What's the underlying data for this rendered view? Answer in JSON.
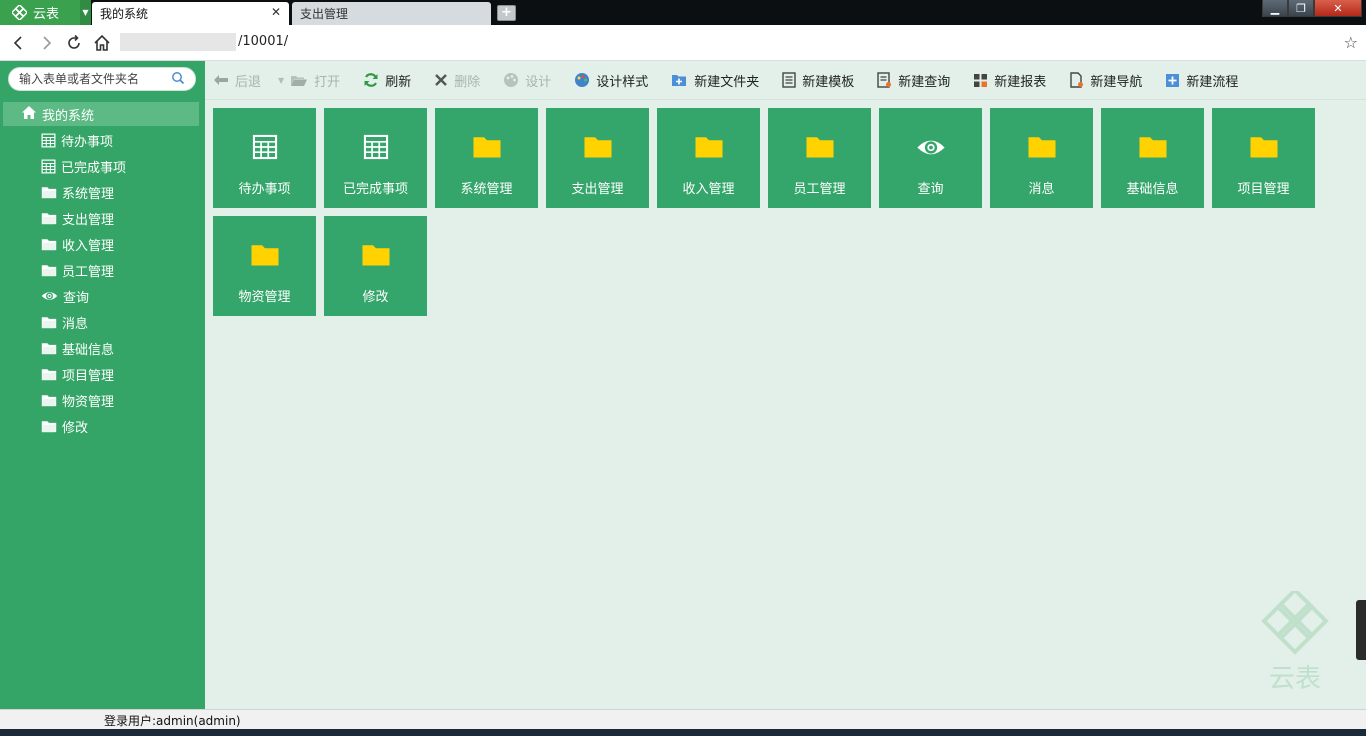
{
  "browser": {
    "app_name": "云表",
    "tabs": [
      {
        "label": "我的系统",
        "active": true
      },
      {
        "label": "支出管理",
        "active": false
      }
    ],
    "url": "/10001/"
  },
  "sidebar": {
    "search_placeholder": "输入表单或者文件夹名",
    "root": {
      "label": "我的系统",
      "icon": "home-icon"
    },
    "items": [
      {
        "label": "待办事项",
        "icon": "table-icon"
      },
      {
        "label": "已完成事项",
        "icon": "table-icon"
      },
      {
        "label": "系统管理",
        "icon": "folder-icon"
      },
      {
        "label": "支出管理",
        "icon": "folder-icon"
      },
      {
        "label": "收入管理",
        "icon": "folder-icon"
      },
      {
        "label": "员工管理",
        "icon": "folder-icon"
      },
      {
        "label": "查询",
        "icon": "eye-icon"
      },
      {
        "label": "消息",
        "icon": "folder-icon"
      },
      {
        "label": "基础信息",
        "icon": "folder-icon"
      },
      {
        "label": "项目管理",
        "icon": "folder-icon"
      },
      {
        "label": "物资管理",
        "icon": "folder-icon"
      },
      {
        "label": "修改",
        "icon": "folder-icon"
      }
    ]
  },
  "toolbar": {
    "back": "后退",
    "open": "打开",
    "refresh": "刷新",
    "delete": "删除",
    "design": "设计",
    "design_style": "设计样式",
    "new_folder": "新建文件夹",
    "new_template": "新建模板",
    "new_query": "新建查询",
    "new_report": "新建报表",
    "new_nav": "新建导航",
    "new_flow": "新建流程"
  },
  "tiles": [
    {
      "label": "待办事项",
      "icon": "table-icon"
    },
    {
      "label": "已完成事项",
      "icon": "table-icon"
    },
    {
      "label": "系统管理",
      "icon": "folder-icon"
    },
    {
      "label": "支出管理",
      "icon": "folder-icon"
    },
    {
      "label": "收入管理",
      "icon": "folder-icon"
    },
    {
      "label": "员工管理",
      "icon": "folder-icon"
    },
    {
      "label": "查询",
      "icon": "eye-icon"
    },
    {
      "label": "消息",
      "icon": "folder-icon"
    },
    {
      "label": "基础信息",
      "icon": "folder-icon"
    },
    {
      "label": "项目管理",
      "icon": "folder-icon"
    },
    {
      "label": "物资管理",
      "icon": "folder-icon"
    },
    {
      "label": "修改",
      "icon": "folder-icon"
    }
  ],
  "status": {
    "user": "登录用户:admin(admin)"
  },
  "colors": {
    "sidebar": "#34a566",
    "tile": "#34a66b",
    "main_bg": "#e2f0e9",
    "folder": "#ffd200"
  }
}
